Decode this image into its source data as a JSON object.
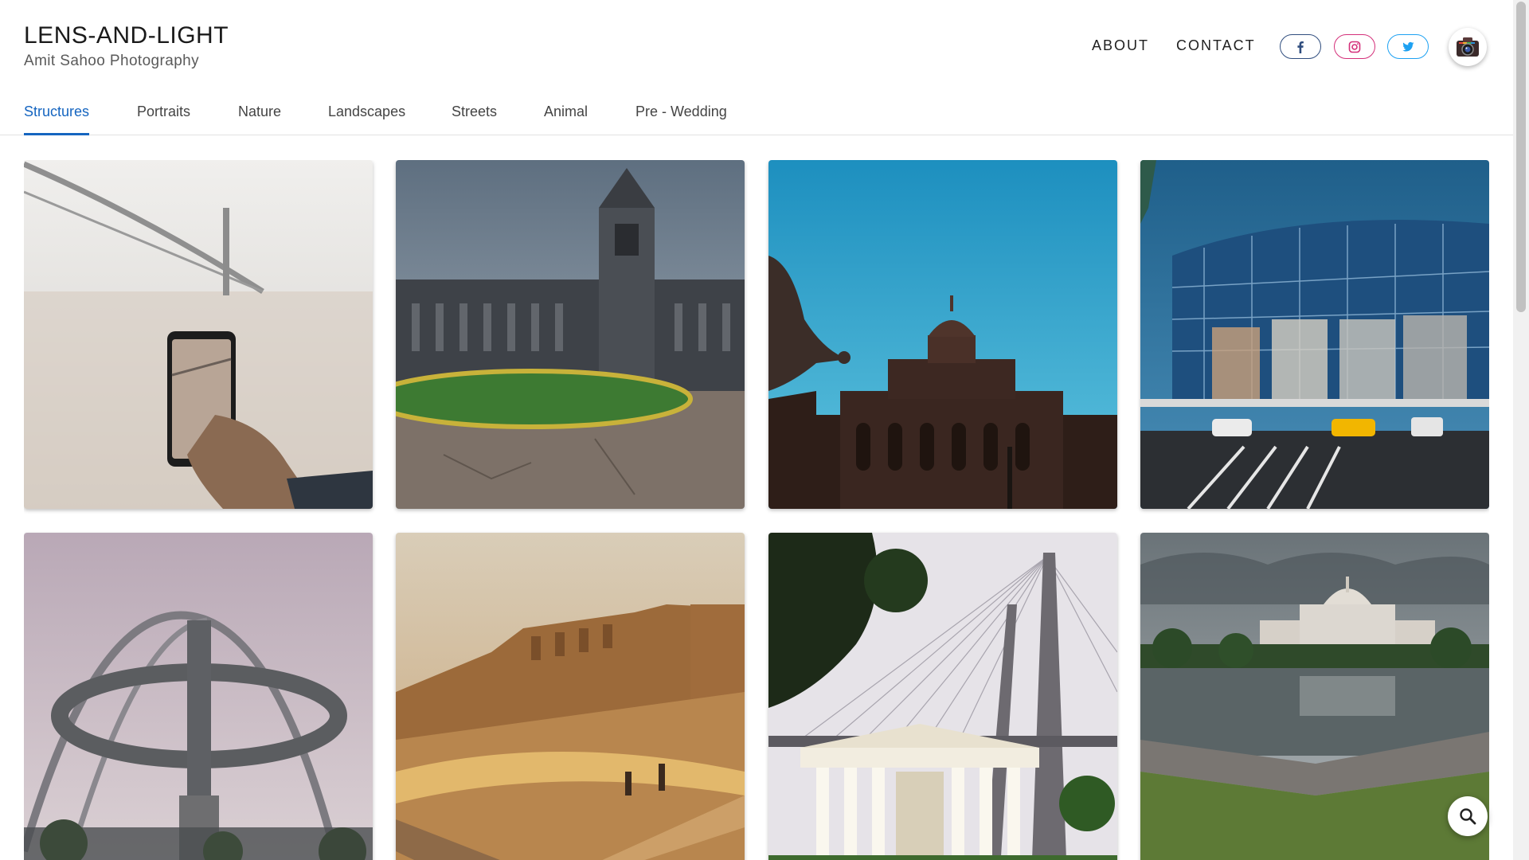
{
  "brand": {
    "title": "LENS-AND-LIGHT",
    "subtitle": "Amit Sahoo Photography"
  },
  "nav": {
    "about": "ABOUT",
    "contact": "CONTACT"
  },
  "social": [
    {
      "name": "facebook-icon",
      "color": "#2f4d7e"
    },
    {
      "name": "instagram-icon",
      "color": "#d4307a"
    },
    {
      "name": "twitter-icon",
      "color": "#1da1f2"
    }
  ],
  "tabs": [
    {
      "label": "Structures",
      "active": true
    },
    {
      "label": "Portraits",
      "active": false
    },
    {
      "label": "Nature",
      "active": false
    },
    {
      "label": "Landscapes",
      "active": false
    },
    {
      "label": "Streets",
      "active": false
    },
    {
      "label": "Animal",
      "active": false
    },
    {
      "label": "Pre - Wedding",
      "active": false
    }
  ],
  "accent_color": "#1565c0",
  "gallery": [
    {
      "subject": "phone-bridge-photo"
    },
    {
      "subject": "cathedral-photo"
    },
    {
      "subject": "palace-pigeon-photo"
    },
    {
      "subject": "cricket-stadium-photo"
    },
    {
      "subject": "arch-tower-photo"
    },
    {
      "subject": "fort-wall-photo"
    },
    {
      "subject": "cable-bridge-temple-photo"
    },
    {
      "subject": "memorial-lake-photo"
    }
  ]
}
